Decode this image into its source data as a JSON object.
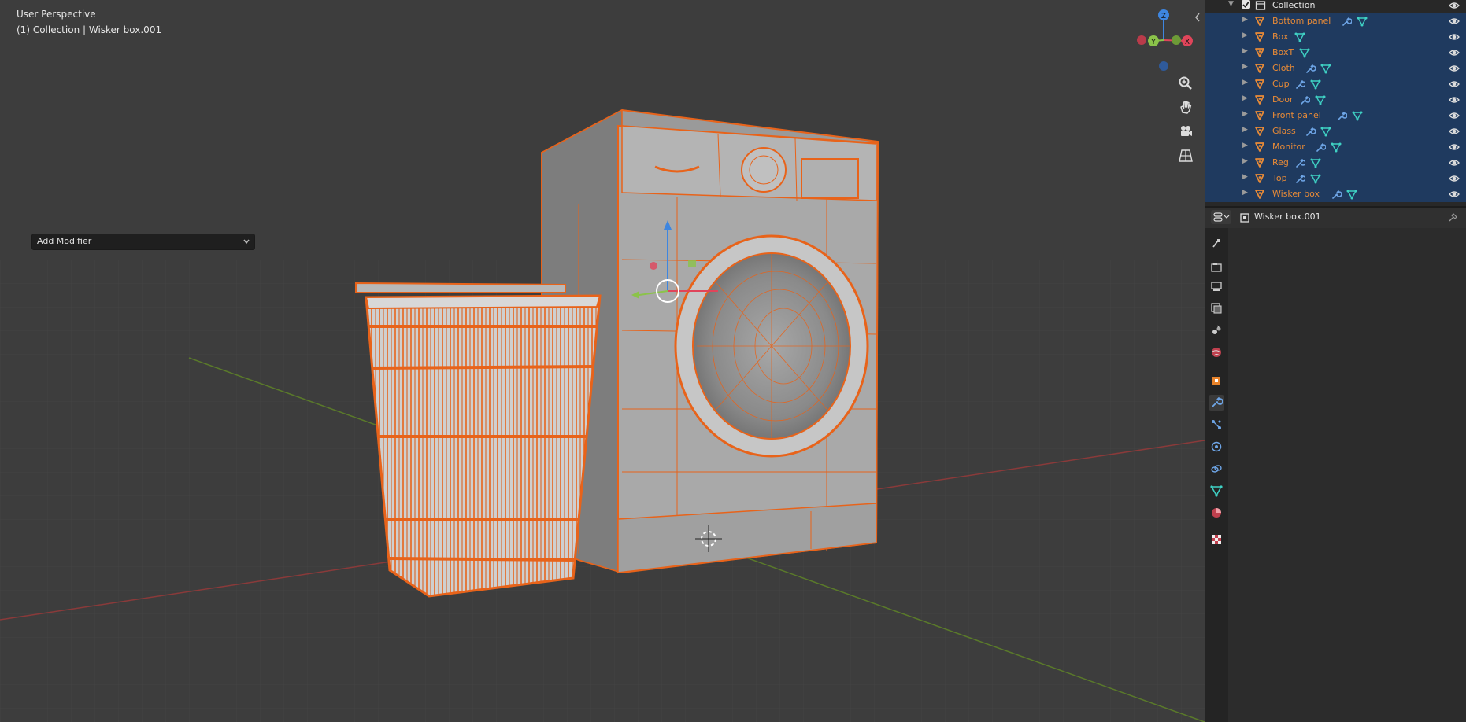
{
  "viewport": {
    "title": "User Perspective",
    "subtitle": "(1) Collection | Wisker box.001",
    "gizmo": {
      "z_label": "Z",
      "y_label": "Y",
      "x_label": "X"
    },
    "nav_icons": [
      "zoom-icon",
      "hand-pan-icon",
      "camera-icon",
      "grid-ortho-icon"
    ]
  },
  "outliner": {
    "collection_label": "Collection",
    "items": [
      {
        "label": "Bottom panel",
        "modifier": true
      },
      {
        "label": "Box",
        "modifier": false
      },
      {
        "label": "BoxT",
        "modifier": false
      },
      {
        "label": "Cloth",
        "modifier": true
      },
      {
        "label": "Cup",
        "modifier": true
      },
      {
        "label": "Door",
        "modifier": true
      },
      {
        "label": "Front panel",
        "modifier": true
      },
      {
        "label": "Glass",
        "modifier": true
      },
      {
        "label": "Monitor",
        "modifier": true
      },
      {
        "label": "Reg",
        "modifier": true
      },
      {
        "label": "Top",
        "modifier": true
      },
      {
        "label": "Wisker box",
        "modifier": true
      }
    ]
  },
  "properties": {
    "object_name": "Wisker box.001",
    "add_modifier_label": "Add Modifier",
    "tabs": [
      "tool-icon",
      "render-icon",
      "output-icon",
      "view-layer-icon",
      "scene-icon",
      "world-icon",
      "object-icon",
      "modifier-icon",
      "particles-icon",
      "physics-icon",
      "constraints-icon",
      "data-icon",
      "material-icon",
      "texture-icon"
    ],
    "active_tab": "modifier-icon"
  },
  "colors": {
    "selection_orange": "#e8631a",
    "outliner_selected": "#1f3a5f",
    "axis_x": "#e0455a",
    "axis_y": "#8bc34a",
    "axis_z": "#3e86e0"
  }
}
